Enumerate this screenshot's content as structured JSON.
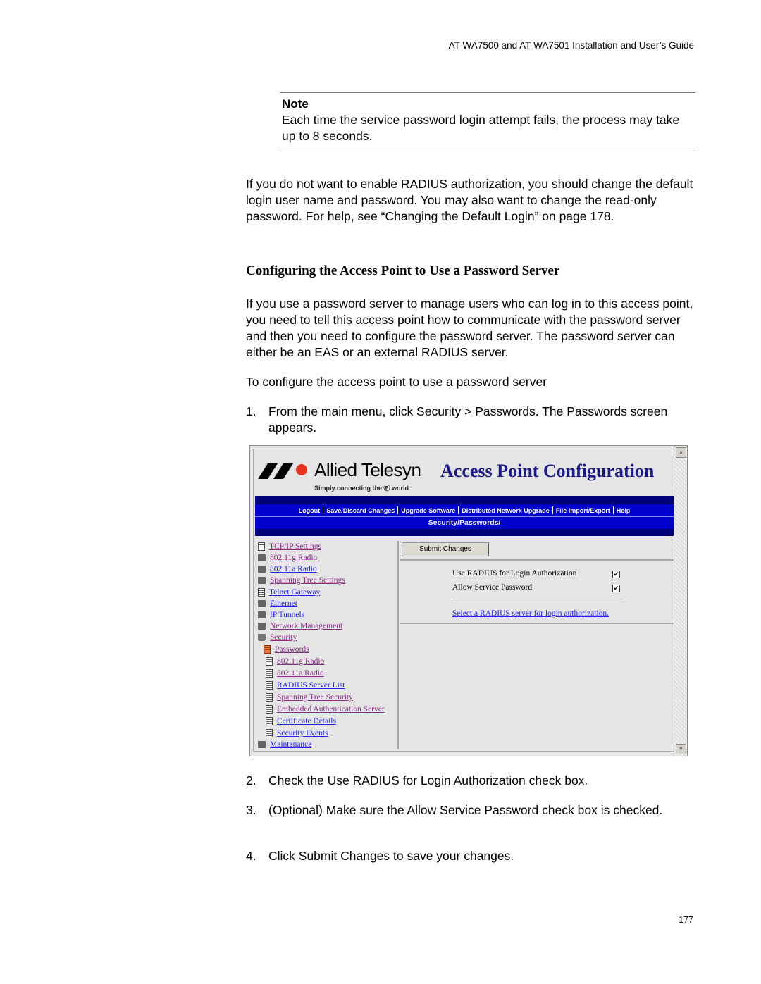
{
  "running_header": "AT-WA7500 and AT-WA7501 Installation and User’s Guide",
  "note": {
    "title": "Note",
    "body": "Each time the service password login attempt fails, the process may take up to 8 seconds."
  },
  "para_radius": "If you do not want to enable RADIUS authorization, you should change the default login user name and password. You may also want to change the read-only password. For help, see “Changing the Default Login” on page 178.",
  "section_heading": "Configuring the Access Point to Use a Password Server",
  "para_intro": "If you use a password server to manage users who can log in to this access point, you need to tell this access point how to communicate with the password server and then you need to configure the password server. The password server can either be an EAS or an external RADIUS server.",
  "para_procedure": "To configure the access point to use a password server",
  "steps": [
    {
      "num": "1.",
      "text": "From the main menu, click Security > Passwords. The Passwords screen appears."
    },
    {
      "num": "2.",
      "text": "Check the Use RADIUS for Login Authorization check box."
    },
    {
      "num": "3.",
      "text": "(Optional) Make sure the Allow Service Password check box is checked."
    },
    {
      "num": "4.",
      "text": "Click Submit Changes to save your changes."
    }
  ],
  "page_number": "177",
  "screenshot": {
    "logo_text": "Allied Telesyn",
    "logo_tagline": "Simply connecting the Ⓟ world",
    "title": "Access Point Configuration",
    "nav": [
      "Logout",
      "Save/Discard Changes",
      "Upgrade Software",
      "Distributed Network Upgrade",
      "File Import/Export",
      "Help"
    ],
    "breadcrumb": "Security/Passwords/",
    "tree": [
      {
        "label": "TCP/IP Settings",
        "icon": "document-icon",
        "state": "visited"
      },
      {
        "label": "802.11g Radio",
        "icon": "folder-icon",
        "state": "visited"
      },
      {
        "label": "802.11a Radio",
        "icon": "folder-icon",
        "state": "link"
      },
      {
        "label": "Spanning Tree Settings",
        "icon": "folder-icon",
        "state": "visited"
      },
      {
        "label": "Telnet Gateway",
        "icon": "document-icon",
        "state": "link"
      },
      {
        "label": "Ethernet",
        "icon": "folder-icon",
        "state": "link"
      },
      {
        "label": "IP Tunnels",
        "icon": "folder-icon",
        "state": "link"
      },
      {
        "label": "Network Management",
        "icon": "folder-icon",
        "state": "visited"
      },
      {
        "label": "Security",
        "icon": "open-folder-icon",
        "state": "visited"
      },
      {
        "label": "Passwords",
        "icon": "current-document-icon",
        "state": "visited"
      },
      {
        "label": "802.11g Radio",
        "icon": "document-icon",
        "state": "visited"
      },
      {
        "label": "802.11a Radio",
        "icon": "document-icon",
        "state": "visited"
      },
      {
        "label": "RADIUS Server List",
        "icon": "document-icon",
        "state": "link"
      },
      {
        "label": "Spanning Tree Security",
        "icon": "document-icon",
        "state": "visited"
      },
      {
        "label": "Embedded Authentication Server",
        "icon": "document-icon",
        "state": "visited"
      },
      {
        "label": "Certificate Details",
        "icon": "document-icon",
        "state": "link"
      },
      {
        "label": "Security Events",
        "icon": "document-icon",
        "state": "link"
      },
      {
        "label": "Maintenance",
        "icon": "folder-icon",
        "state": "link"
      }
    ],
    "submit_label": "Submit Changes",
    "options": [
      {
        "label": "Use RADIUS for Login Authorization",
        "checked": true,
        "mark": "✔"
      },
      {
        "label": "Allow Service Password",
        "checked": true,
        "mark": "✔"
      }
    ],
    "radius_link": "Select a RADIUS server for login authorization."
  }
}
